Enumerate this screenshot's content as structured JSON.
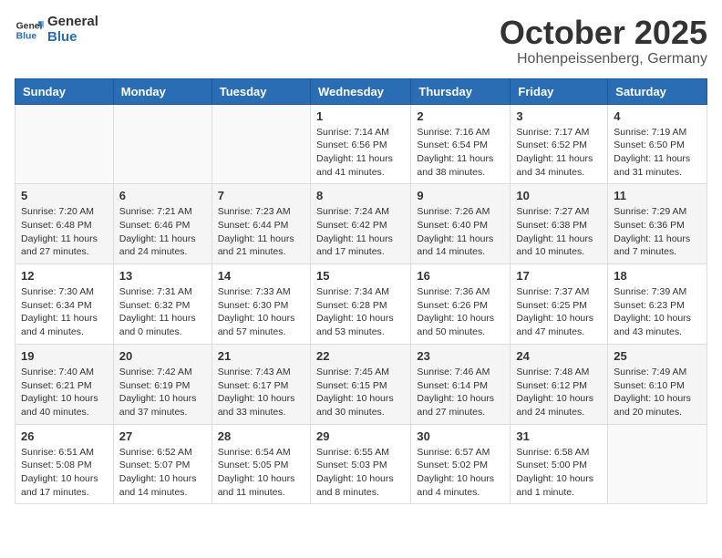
{
  "header": {
    "logo_general": "General",
    "logo_blue": "Blue",
    "month_title": "October 2025",
    "location": "Hohenpeissenberg, Germany"
  },
  "days_of_week": [
    "Sunday",
    "Monday",
    "Tuesday",
    "Wednesday",
    "Thursday",
    "Friday",
    "Saturday"
  ],
  "weeks": [
    [
      {
        "day": "",
        "info": ""
      },
      {
        "day": "",
        "info": ""
      },
      {
        "day": "",
        "info": ""
      },
      {
        "day": "1",
        "info": "Sunrise: 7:14 AM\nSunset: 6:56 PM\nDaylight: 11 hours and 41 minutes."
      },
      {
        "day": "2",
        "info": "Sunrise: 7:16 AM\nSunset: 6:54 PM\nDaylight: 11 hours and 38 minutes."
      },
      {
        "day": "3",
        "info": "Sunrise: 7:17 AM\nSunset: 6:52 PM\nDaylight: 11 hours and 34 minutes."
      },
      {
        "day": "4",
        "info": "Sunrise: 7:19 AM\nSunset: 6:50 PM\nDaylight: 11 hours and 31 minutes."
      }
    ],
    [
      {
        "day": "5",
        "info": "Sunrise: 7:20 AM\nSunset: 6:48 PM\nDaylight: 11 hours and 27 minutes."
      },
      {
        "day": "6",
        "info": "Sunrise: 7:21 AM\nSunset: 6:46 PM\nDaylight: 11 hours and 24 minutes."
      },
      {
        "day": "7",
        "info": "Sunrise: 7:23 AM\nSunset: 6:44 PM\nDaylight: 11 hours and 21 minutes."
      },
      {
        "day": "8",
        "info": "Sunrise: 7:24 AM\nSunset: 6:42 PM\nDaylight: 11 hours and 17 minutes."
      },
      {
        "day": "9",
        "info": "Sunrise: 7:26 AM\nSunset: 6:40 PM\nDaylight: 11 hours and 14 minutes."
      },
      {
        "day": "10",
        "info": "Sunrise: 7:27 AM\nSunset: 6:38 PM\nDaylight: 11 hours and 10 minutes."
      },
      {
        "day": "11",
        "info": "Sunrise: 7:29 AM\nSunset: 6:36 PM\nDaylight: 11 hours and 7 minutes."
      }
    ],
    [
      {
        "day": "12",
        "info": "Sunrise: 7:30 AM\nSunset: 6:34 PM\nDaylight: 11 hours and 4 minutes."
      },
      {
        "day": "13",
        "info": "Sunrise: 7:31 AM\nSunset: 6:32 PM\nDaylight: 11 hours and 0 minutes."
      },
      {
        "day": "14",
        "info": "Sunrise: 7:33 AM\nSunset: 6:30 PM\nDaylight: 10 hours and 57 minutes."
      },
      {
        "day": "15",
        "info": "Sunrise: 7:34 AM\nSunset: 6:28 PM\nDaylight: 10 hours and 53 minutes."
      },
      {
        "day": "16",
        "info": "Sunrise: 7:36 AM\nSunset: 6:26 PM\nDaylight: 10 hours and 50 minutes."
      },
      {
        "day": "17",
        "info": "Sunrise: 7:37 AM\nSunset: 6:25 PM\nDaylight: 10 hours and 47 minutes."
      },
      {
        "day": "18",
        "info": "Sunrise: 7:39 AM\nSunset: 6:23 PM\nDaylight: 10 hours and 43 minutes."
      }
    ],
    [
      {
        "day": "19",
        "info": "Sunrise: 7:40 AM\nSunset: 6:21 PM\nDaylight: 10 hours and 40 minutes."
      },
      {
        "day": "20",
        "info": "Sunrise: 7:42 AM\nSunset: 6:19 PM\nDaylight: 10 hours and 37 minutes."
      },
      {
        "day": "21",
        "info": "Sunrise: 7:43 AM\nSunset: 6:17 PM\nDaylight: 10 hours and 33 minutes."
      },
      {
        "day": "22",
        "info": "Sunrise: 7:45 AM\nSunset: 6:15 PM\nDaylight: 10 hours and 30 minutes."
      },
      {
        "day": "23",
        "info": "Sunrise: 7:46 AM\nSunset: 6:14 PM\nDaylight: 10 hours and 27 minutes."
      },
      {
        "day": "24",
        "info": "Sunrise: 7:48 AM\nSunset: 6:12 PM\nDaylight: 10 hours and 24 minutes."
      },
      {
        "day": "25",
        "info": "Sunrise: 7:49 AM\nSunset: 6:10 PM\nDaylight: 10 hours and 20 minutes."
      }
    ],
    [
      {
        "day": "26",
        "info": "Sunrise: 6:51 AM\nSunset: 5:08 PM\nDaylight: 10 hours and 17 minutes."
      },
      {
        "day": "27",
        "info": "Sunrise: 6:52 AM\nSunset: 5:07 PM\nDaylight: 10 hours and 14 minutes."
      },
      {
        "day": "28",
        "info": "Sunrise: 6:54 AM\nSunset: 5:05 PM\nDaylight: 10 hours and 11 minutes."
      },
      {
        "day": "29",
        "info": "Sunrise: 6:55 AM\nSunset: 5:03 PM\nDaylight: 10 hours and 8 minutes."
      },
      {
        "day": "30",
        "info": "Sunrise: 6:57 AM\nSunset: 5:02 PM\nDaylight: 10 hours and 4 minutes."
      },
      {
        "day": "31",
        "info": "Sunrise: 6:58 AM\nSunset: 5:00 PM\nDaylight: 10 hours and 1 minute."
      },
      {
        "day": "",
        "info": ""
      }
    ]
  ]
}
